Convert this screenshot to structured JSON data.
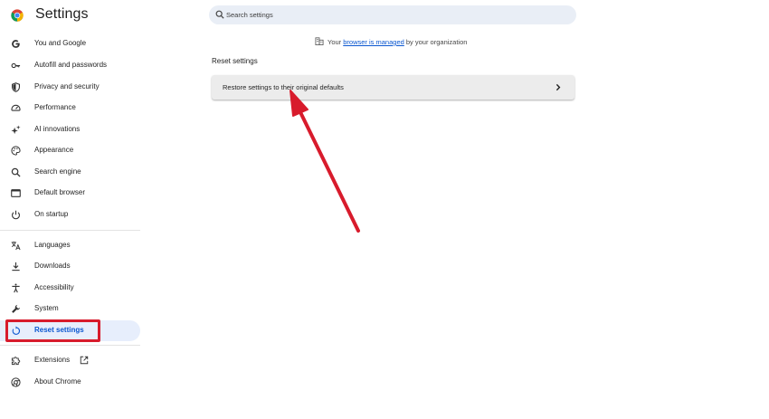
{
  "app": {
    "title": "Settings"
  },
  "search": {
    "placeholder": "Search settings"
  },
  "managed": {
    "prefix": "Your ",
    "link": "browser is managed",
    "suffix": " by your organization"
  },
  "section": {
    "title": "Reset settings"
  },
  "reset_card": {
    "label": "Restore settings to their original defaults"
  },
  "sidebar": {
    "items": [
      {
        "label": "You and Google",
        "icon": "google-g-icon"
      },
      {
        "label": "Autofill and passwords",
        "icon": "key-icon"
      },
      {
        "label": "Privacy and security",
        "icon": "shield-icon"
      },
      {
        "label": "Performance",
        "icon": "speedometer-icon"
      },
      {
        "label": "AI innovations",
        "icon": "sparkle-icon"
      },
      {
        "label": "Appearance",
        "icon": "palette-icon"
      },
      {
        "label": "Search engine",
        "icon": "search-icon"
      },
      {
        "label": "Default browser",
        "icon": "browser-window-icon"
      },
      {
        "label": "On startup",
        "icon": "power-icon"
      },
      {
        "label": "Languages",
        "icon": "translate-icon"
      },
      {
        "label": "Downloads",
        "icon": "download-icon"
      },
      {
        "label": "Accessibility",
        "icon": "accessibility-icon"
      },
      {
        "label": "System",
        "icon": "wrench-icon"
      },
      {
        "label": "Reset settings",
        "icon": "reset-icon",
        "active": true
      },
      {
        "label": "Extensions",
        "icon": "puzzle-icon"
      },
      {
        "label": "About Chrome",
        "icon": "chrome-icon"
      }
    ]
  },
  "colors": {
    "accent": "#0b57d0",
    "active_bg": "#e7eefc",
    "annotation": "#d81b2c",
    "search_bg": "#e9eef6"
  }
}
